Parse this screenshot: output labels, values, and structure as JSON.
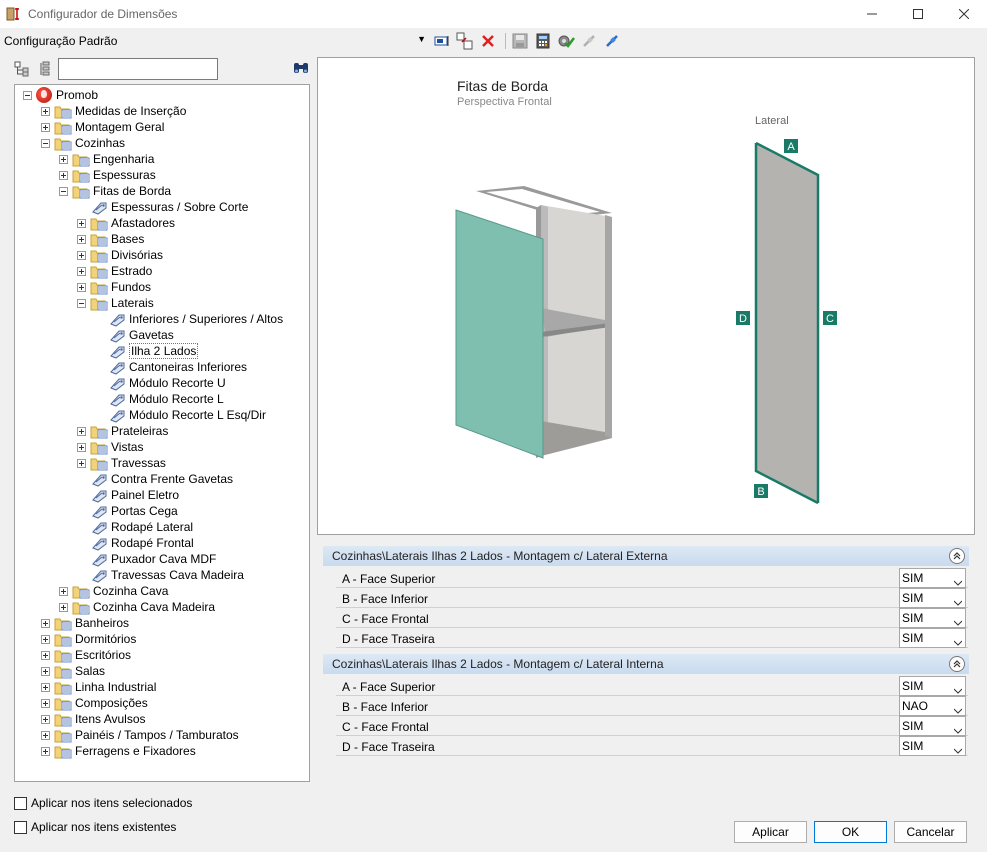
{
  "window": {
    "title": "Configurador de Dimensões"
  },
  "toolbar": {
    "config_value": "Configuração Padrão"
  },
  "tree": [
    {
      "label": "Promob",
      "level": 0,
      "toggle": "minus",
      "icon": "globe"
    },
    {
      "label": "Medidas de Inserção",
      "level": 1,
      "toggle": "plus",
      "icon": "folder"
    },
    {
      "label": "Montagem Geral",
      "level": 1,
      "toggle": "plus",
      "icon": "folder"
    },
    {
      "label": "Cozinhas",
      "level": 1,
      "toggle": "minus",
      "icon": "folder"
    },
    {
      "label": "Engenharia",
      "level": 2,
      "toggle": "plus",
      "icon": "folder"
    },
    {
      "label": "Espessuras",
      "level": 2,
      "toggle": "plus",
      "icon": "folder"
    },
    {
      "label": "Fitas de Borda",
      "level": 2,
      "toggle": "minus",
      "icon": "folder"
    },
    {
      "label": "Espessuras / Sobre Corte",
      "level": 3,
      "toggle": "none",
      "icon": "tag"
    },
    {
      "label": "Afastadores",
      "level": 3,
      "toggle": "plus",
      "icon": "folder"
    },
    {
      "label": "Bases",
      "level": 3,
      "toggle": "plus",
      "icon": "folder"
    },
    {
      "label": "Divisórias",
      "level": 3,
      "toggle": "plus",
      "icon": "folder"
    },
    {
      "label": "Estrado",
      "level": 3,
      "toggle": "plus",
      "icon": "folder"
    },
    {
      "label": "Fundos",
      "level": 3,
      "toggle": "plus",
      "icon": "folder"
    },
    {
      "label": "Laterais",
      "level": 3,
      "toggle": "minus",
      "icon": "folder"
    },
    {
      "label": "Inferiores / Superiores / Altos",
      "level": 4,
      "toggle": "none",
      "icon": "tag"
    },
    {
      "label": "Gavetas",
      "level": 4,
      "toggle": "none",
      "icon": "tag"
    },
    {
      "label": "Ilha 2 Lados",
      "level": 4,
      "toggle": "none",
      "icon": "tag",
      "selected": true
    },
    {
      "label": "Cantoneiras Inferiores",
      "level": 4,
      "toggle": "none",
      "icon": "tag"
    },
    {
      "label": "Módulo Recorte U",
      "level": 4,
      "toggle": "none",
      "icon": "tag"
    },
    {
      "label": "Módulo Recorte L",
      "level": 4,
      "toggle": "none",
      "icon": "tag"
    },
    {
      "label": "Módulo Recorte L Esq/Dir",
      "level": 4,
      "toggle": "none",
      "icon": "tag"
    },
    {
      "label": "Prateleiras",
      "level": 3,
      "toggle": "plus",
      "icon": "folder"
    },
    {
      "label": "Vistas",
      "level": 3,
      "toggle": "plus",
      "icon": "folder"
    },
    {
      "label": "Travessas",
      "level": 3,
      "toggle": "plus",
      "icon": "folder"
    },
    {
      "label": "Contra Frente Gavetas",
      "level": 3,
      "toggle": "none",
      "icon": "tag"
    },
    {
      "label": "Painel Eletro",
      "level": 3,
      "toggle": "none",
      "icon": "tag"
    },
    {
      "label": "Portas Cega",
      "level": 3,
      "toggle": "none",
      "icon": "tag"
    },
    {
      "label": "Rodapé Lateral",
      "level": 3,
      "toggle": "none",
      "icon": "tag"
    },
    {
      "label": "Rodapé Frontal",
      "level": 3,
      "toggle": "none",
      "icon": "tag"
    },
    {
      "label": "Puxador Cava MDF",
      "level": 3,
      "toggle": "none",
      "icon": "tag"
    },
    {
      "label": "Travessas Cava Madeira",
      "level": 3,
      "toggle": "none",
      "icon": "tag"
    },
    {
      "label": "Cozinha Cava",
      "level": 2,
      "toggle": "plus",
      "icon": "folder"
    },
    {
      "label": "Cozinha Cava Madeira",
      "level": 2,
      "toggle": "plus",
      "icon": "folder"
    },
    {
      "label": "Banheiros",
      "level": 1,
      "toggle": "plus",
      "icon": "folder"
    },
    {
      "label": "Dormitórios",
      "level": 1,
      "toggle": "plus",
      "icon": "folder"
    },
    {
      "label": "Escritórios",
      "level": 1,
      "toggle": "plus",
      "icon": "folder"
    },
    {
      "label": "Salas",
      "level": 1,
      "toggle": "plus",
      "icon": "folder"
    },
    {
      "label": "Linha Industrial",
      "level": 1,
      "toggle": "plus",
      "icon": "folder"
    },
    {
      "label": "Composições",
      "level": 1,
      "toggle": "plus",
      "icon": "folder"
    },
    {
      "label": "Itens Avulsos",
      "level": 1,
      "toggle": "plus",
      "icon": "folder"
    },
    {
      "label": "Painéis / Tampos / Tamburatos",
      "level": 1,
      "toggle": "plus",
      "icon": "folder"
    },
    {
      "label": "Ferragens e Fixadores",
      "level": 1,
      "toggle": "plus",
      "icon": "folder"
    }
  ],
  "preview": {
    "title": "Fitas de Borda",
    "subtitle": "Perspectiva Frontal",
    "lateral_label": "Lateral",
    "edge_a": "A",
    "edge_b": "B",
    "edge_c": "C",
    "edge_d": "D",
    "edge_color": "#1a7a68",
    "panel_color": "#7fbfb0"
  },
  "groups": [
    {
      "title": "Cozinhas\\Laterais Ilhas 2 Lados - Montagem c/ Lateral Externa",
      "rows": [
        {
          "label": "A - Face Superior",
          "value": "SIM"
        },
        {
          "label": "B - Face Inferior",
          "value": "SIM"
        },
        {
          "label": "C - Face Frontal",
          "value": "SIM"
        },
        {
          "label": "D - Face Traseira",
          "value": "SIM"
        }
      ]
    },
    {
      "title": "Cozinhas\\Laterais Ilhas 2 Lados - Montagem c/ Lateral Interna",
      "rows": [
        {
          "label": "A - Face Superior",
          "value": "SIM"
        },
        {
          "label": "B - Face Inferior",
          "value": "NAO"
        },
        {
          "label": "C - Face Frontal",
          "value": "SIM"
        },
        {
          "label": "D - Face Traseira",
          "value": "SIM"
        }
      ]
    }
  ],
  "options": {
    "apply_selected": "Aplicar nos itens selecionados",
    "apply_existing": "Aplicar nos itens existentes"
  },
  "buttons": {
    "apply": "Aplicar",
    "ok": "OK",
    "cancel": "Cancelar"
  }
}
